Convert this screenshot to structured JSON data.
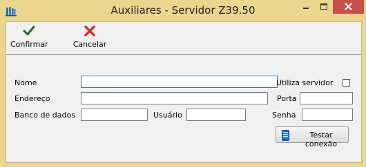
{
  "window": {
    "title": "Auxiliares - Servidor Z39.50",
    "colors": {
      "frame": "#ead68f",
      "close": "#c8504b",
      "client": "#f0f0f0"
    }
  },
  "toolbar": {
    "confirm_label": "Confirmar",
    "confirm_icon": "checkmark-icon",
    "cancel_label": "Cancelar",
    "cancel_icon": "x-icon"
  },
  "form": {
    "nome": {
      "label": "Nome",
      "value": ""
    },
    "utiliza_servidor": {
      "label": "Utiliza servidor",
      "checked": false
    },
    "endereco": {
      "label": "Endereço",
      "value": ""
    },
    "porta": {
      "label": "Porta",
      "value": ""
    },
    "banco_de_dados": {
      "label": "Banco de dados",
      "value": ""
    },
    "usuario": {
      "label": "Usuário",
      "value": ""
    },
    "senha": {
      "label": "Senha",
      "value": ""
    },
    "test_button": {
      "label": "Testar conexão",
      "icon": "server-icon"
    }
  }
}
